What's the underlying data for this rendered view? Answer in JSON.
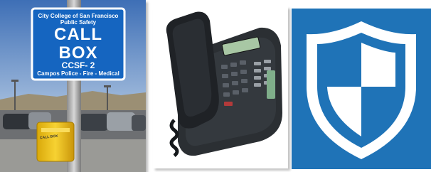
{
  "images": {
    "callbox_photo": {
      "sign": {
        "line1": "City College of San Francisco",
        "line2": "Public Safety",
        "line3": "CALL",
        "line4": "BOX",
        "line5": "CCSF- 2",
        "line6": "Campos Police - Fire - Medical"
      },
      "box_label": "CALL BOX"
    },
    "phone_photo": {},
    "shield_icon": {}
  },
  "colors": {
    "sky": "#5a86c6",
    "sign_blue": "#1565c0",
    "callbox_yellow": "#f2c81a",
    "shield_tile": "#1f73b7",
    "phone_body": "#2b2f33"
  }
}
